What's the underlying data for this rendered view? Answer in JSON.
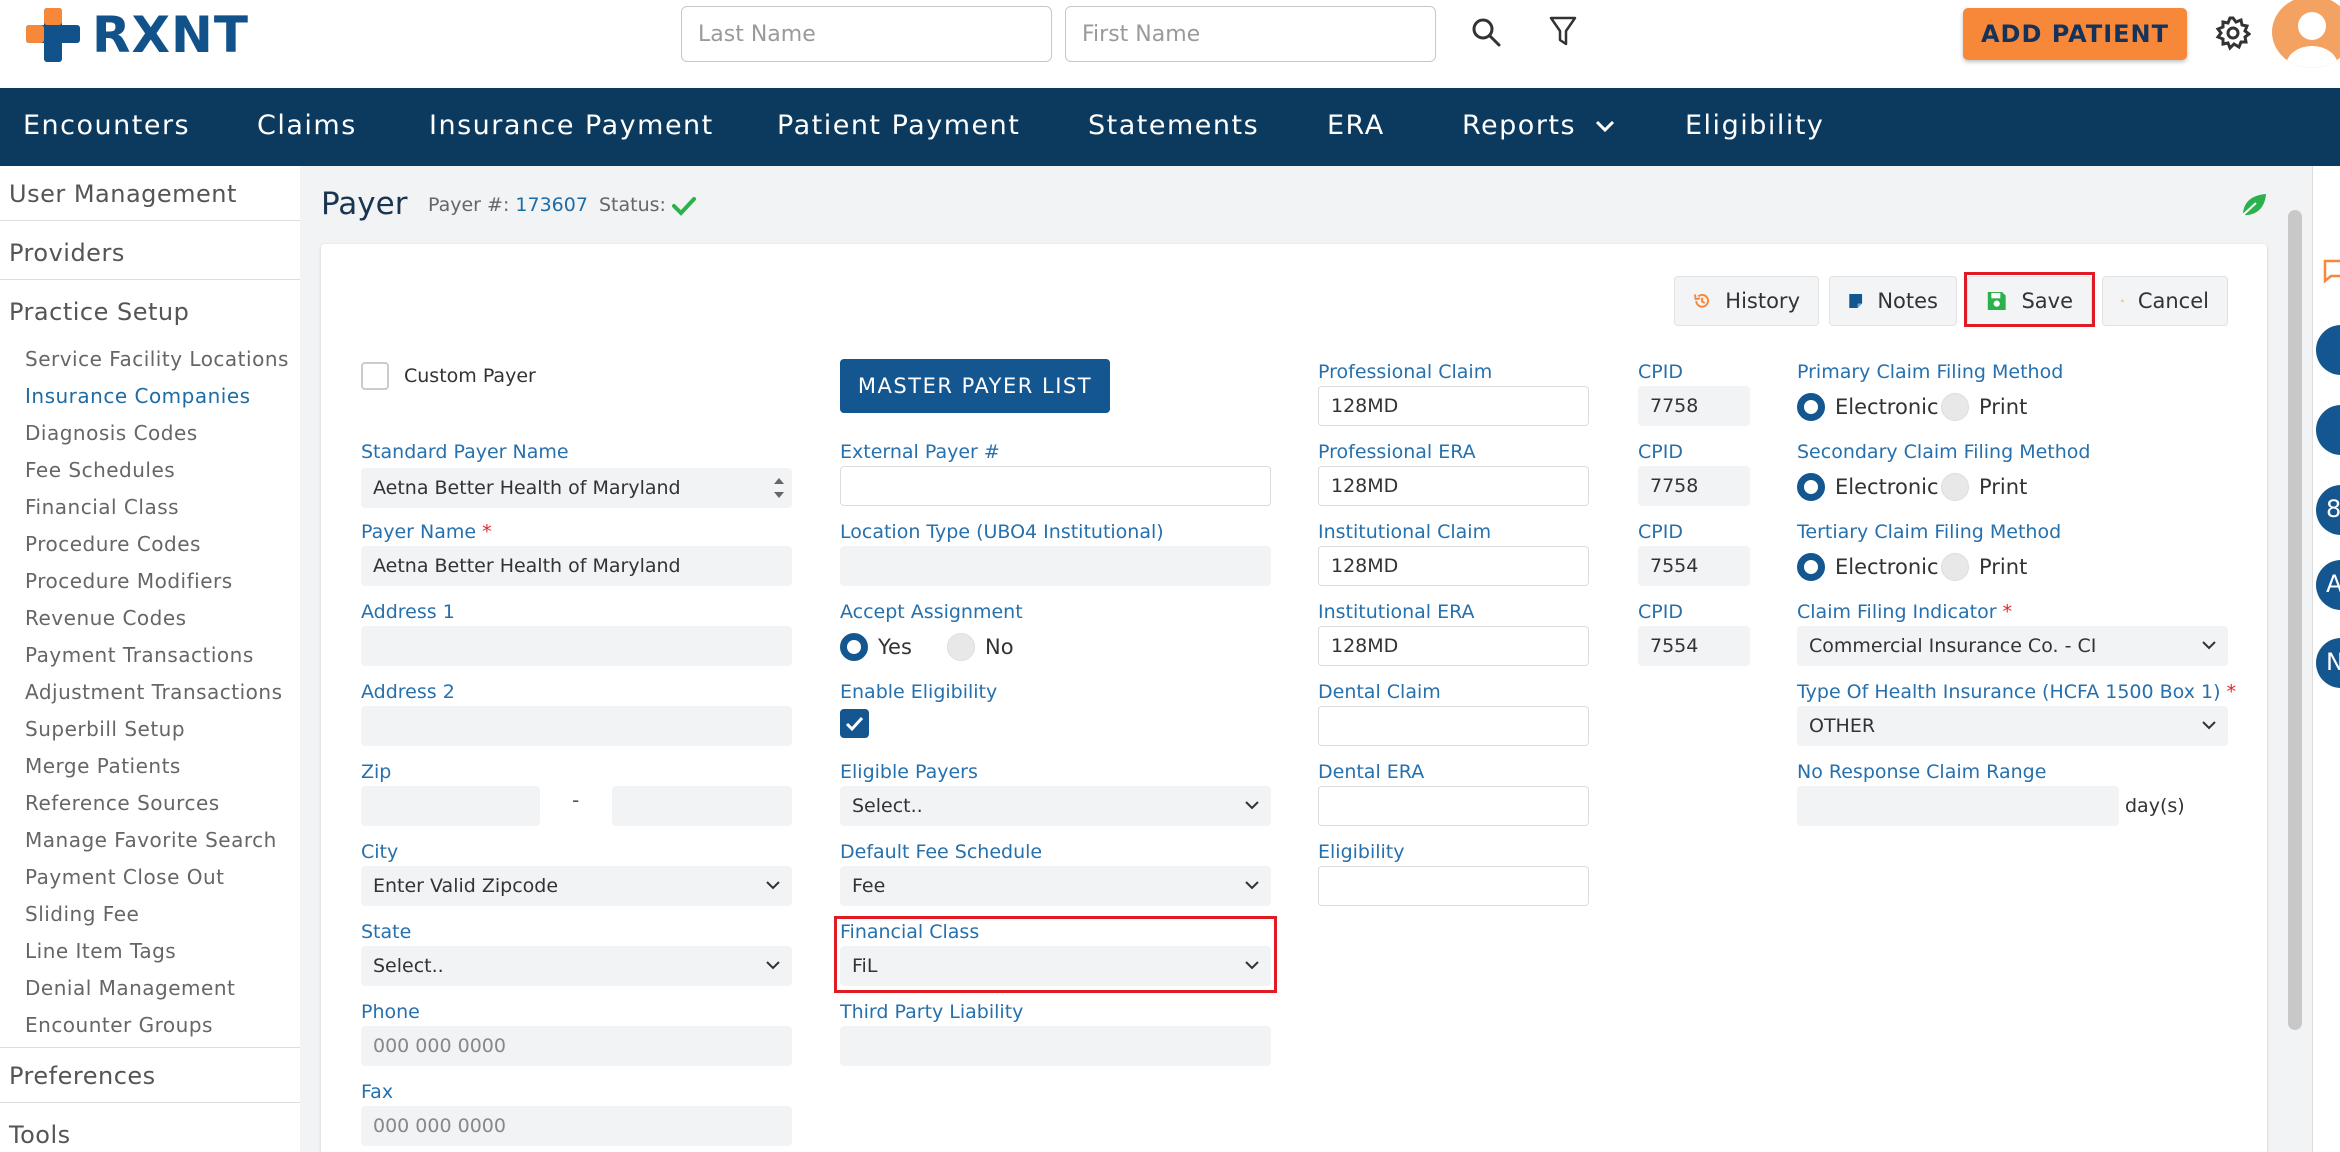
{
  "brand": {
    "name": "RXNT",
    "colors": {
      "primary": "#0b3a5e",
      "accent": "#f7883a",
      "link": "#2670ad"
    }
  },
  "header": {
    "last_name_placeholder": "Last Name",
    "first_name_placeholder": "First Name",
    "add_patient_label": "ADD PATIENT"
  },
  "nav": {
    "encounters": "Encounters",
    "claims": "Claims",
    "insurance_payment": "Insurance Payment",
    "patient_payment": "Patient Payment",
    "statements": "Statements",
    "era": "ERA",
    "reports": "Reports",
    "eligibility": "Eligibility"
  },
  "sidebar": {
    "user_management": "User Management",
    "providers": "Providers",
    "practice_setup": "Practice Setup",
    "items": [
      "Service Facility Locations",
      "Insurance Companies",
      "Diagnosis Codes",
      "Fee Schedules",
      "Financial Class",
      "Procedure Codes",
      "Procedure Modifiers",
      "Revenue Codes",
      "Payment Transactions",
      "Adjustment Transactions",
      "Superbill Setup",
      "Merge Patients",
      "Reference Sources",
      "Manage Favorite Search",
      "Payment Close Out",
      "Sliding Fee",
      "Line Item Tags",
      "Denial Management",
      "Encounter Groups"
    ],
    "preferences": "Preferences",
    "tools": "Tools"
  },
  "page": {
    "title": "Payer",
    "payer_num_label": "Payer #:",
    "payer_num": "173607",
    "status_label": "Status:"
  },
  "toolbar": {
    "history": "History",
    "notes": "Notes",
    "save": "Save",
    "cancel": "Cancel"
  },
  "form": {
    "custom_payer": "Custom Payer",
    "master_payer_list": "MASTER PAYER LIST",
    "standard_payer_name_label": "Standard Payer Name",
    "standard_payer_name": "Aetna Better Health of Maryland",
    "payer_name_label": "Payer Name",
    "payer_name": "Aetna Better Health of Maryland",
    "address1_label": "Address 1",
    "address2_label": "Address 2",
    "zip_label": "Zip",
    "zip_dash": "-",
    "city_label": "City",
    "city_value": "Enter Valid Zipcode",
    "state_label": "State",
    "state_value": "Select..",
    "phone_label": "Phone",
    "phone_placeholder": "000 000 0000",
    "fax_label": "Fax",
    "fax_placeholder": "000 000 0000",
    "external_payer_label": "External Payer #",
    "location_type_label": "Location Type (UBO4 Institutional)",
    "accept_assignment_label": "Accept Assignment",
    "yes": "Yes",
    "no": "No",
    "enable_eligibility_label": "Enable Eligibility",
    "eligible_payers_label": "Eligible Payers",
    "eligible_payers_value": "Select..",
    "default_fee_schedule_label": "Default Fee Schedule",
    "default_fee_schedule_value": "Fee",
    "financial_class_label": "Financial Class",
    "financial_class_value": "FiL",
    "third_party_label": "Third Party Liability",
    "professional_claim_label": "Professional Claim",
    "professional_claim": "128MD",
    "professional_era_label": "Professional ERA",
    "professional_era": "128MD",
    "institutional_claim_label": "Institutional Claim",
    "institutional_claim": "128MD",
    "institutional_era_label": "Institutional ERA",
    "institutional_era": "128MD",
    "dental_claim_label": "Dental Claim",
    "dental_era_label": "Dental ERA",
    "eligibility_label": "Eligibility",
    "cpid_label": "CPID",
    "cpid1": "7758",
    "cpid2": "7758",
    "cpid3": "7554",
    "cpid4": "7554",
    "primary_method_label": "Primary Claim Filing Method",
    "secondary_method_label": "Secondary Claim Filing Method",
    "tertiary_method_label": "Tertiary Claim Filing Method",
    "electronic": "Electronic",
    "print": "Print",
    "claim_filing_indicator_label": "Claim Filing Indicator",
    "claim_filing_indicator": "Commercial Insurance Co. - CI",
    "type_health_label": "Type Of Health Insurance (HCFA 1500 Box 1)",
    "type_health_value": "OTHER",
    "no_response_label": "No Response Claim Range",
    "days_label": "day(s)",
    "required_mark": "*"
  },
  "right_strip": {
    "letters": [
      "8",
      "A",
      "N"
    ]
  },
  "icons": [
    "search-icon",
    "filter-icon",
    "gear-icon",
    "history-icon",
    "notes-icon",
    "save-icon",
    "cancel-icon",
    "leaf-icon",
    "check-icon",
    "chevron-down-icon"
  ]
}
